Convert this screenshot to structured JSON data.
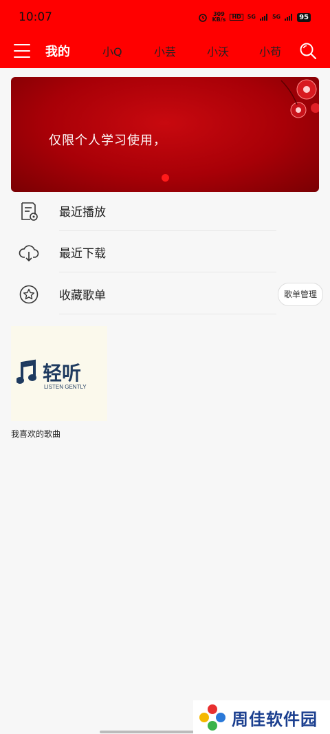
{
  "status_bar": {
    "time": "10:07",
    "net_speed": "309 KB/s",
    "hd": "HD",
    "signal1": "5G",
    "signal2": "5G",
    "battery": "95"
  },
  "nav": {
    "tabs": [
      {
        "label": "我的",
        "active": true
      },
      {
        "label": "小Q",
        "active": false
      },
      {
        "label": "小芸",
        "active": false
      },
      {
        "label": "小沃",
        "active": false
      },
      {
        "label": "小苟",
        "active": false
      }
    ]
  },
  "banner": {
    "text": "仅限个人学习使用，"
  },
  "menu": {
    "recent_play": "最近播放",
    "recent_download": "最近下载",
    "favorites": "收藏歌单",
    "manage_button": "歌单管理"
  },
  "playlist": {
    "cover_logo_text": "轻听",
    "cover_logo_sub": "LISTEN GENTLY",
    "name": "我喜欢的歌曲"
  },
  "watermark": {
    "text": "周佳软件园"
  },
  "colors": {
    "accent": "#ff0000",
    "banner": "#b00008",
    "logo": "#1e3a5f"
  }
}
